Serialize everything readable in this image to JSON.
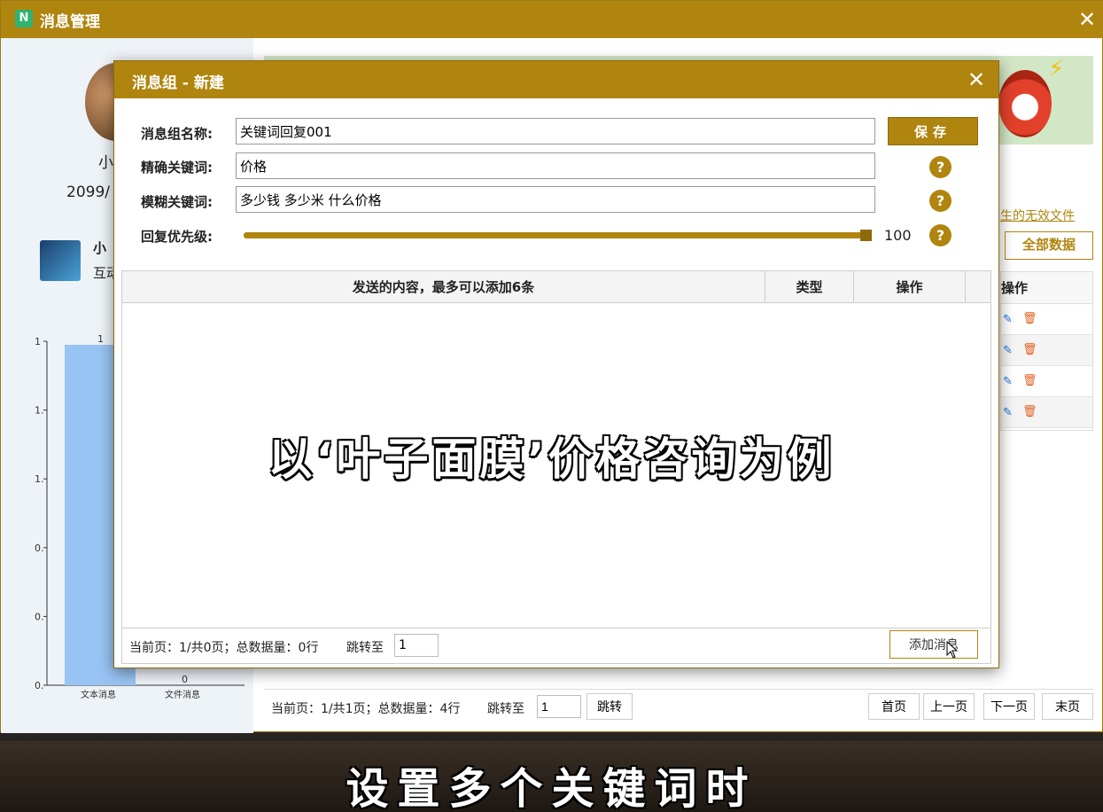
{
  "outer": {
    "logo": "N",
    "title": "消息管理",
    "close": "✕",
    "left": {
      "name": "小",
      "date": "2099/",
      "friend_name": "小",
      "friend_sub": "互动"
    },
    "chart_data": {
      "type": "bar",
      "categories": [
        "文本消息",
        "文件消息"
      ],
      "values": [
        1,
        0
      ],
      "data_labels": [
        "1",
        "0"
      ],
      "y_ticks": [
        "1",
        "1.",
        "1.",
        "0.",
        "0.",
        "0."
      ]
    },
    "right": {
      "link_invalid": "生的无效文件",
      "btn_all": "全部数据",
      "table_head": "操作",
      "rows": 4
    },
    "pager": {
      "info": "当前页：1/共1页；总数据量：4行",
      "jump_label": "跳转至",
      "jump_value": "1",
      "go": "跳转",
      "first": "首页",
      "prev": "上一页",
      "next": "下一页",
      "last": "末页"
    }
  },
  "modal": {
    "title": "消息组 - 新建",
    "close": "✕",
    "fields": {
      "name_label": "消息组名称:",
      "name_value": "关键词回复001",
      "exact_label": "精确关键词:",
      "exact_value": "价格",
      "fuzzy_label": "模糊关键词:",
      "fuzzy_value": "多少钱 多少米 什么价格",
      "priority_label": "回复优先级:",
      "priority_value": "100",
      "priority_fraction": 1.0
    },
    "save": "保存",
    "help": "?",
    "table": {
      "col_content": "发送的内容，最多可以添加6条",
      "col_type": "类型",
      "col_action": "操作"
    },
    "pager": {
      "info": "当前页：1/共0页；总数据量：0行",
      "jump_label": "跳转至",
      "jump_value": "1",
      "add": "添加消息"
    }
  },
  "captions": {
    "overlay": "以‘叶子面膜’价格咨询为例",
    "bottom": "设置多个关键词时"
  }
}
